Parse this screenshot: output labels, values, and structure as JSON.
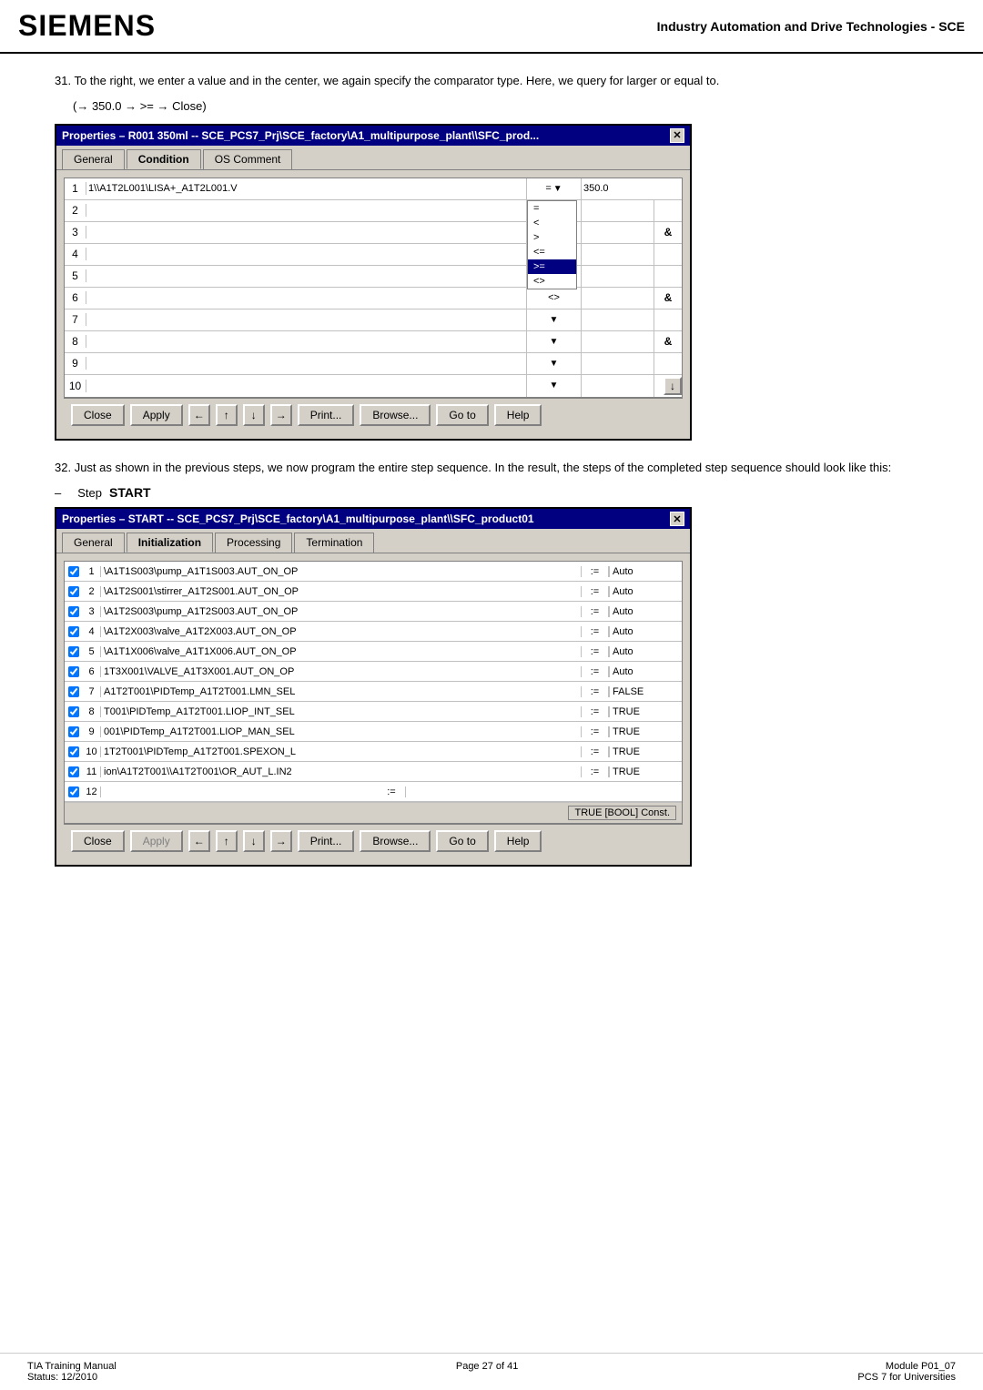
{
  "header": {
    "logo": "SIEMENS",
    "title": "Industry Automation and Drive Technologies - SCE"
  },
  "step31": {
    "number": "31.",
    "text": "To the right, we enter a value and in the center, we again specify the comparator type. Here, we query for larger or equal to.",
    "formula": "(→ 350.0 → >= → Close)"
  },
  "dialog1": {
    "title": "Properties – R001 350ml -- SCE_PCS7_Prj\\SCE_factory\\A1_multipurpose_plant\\\\SFC_prod...",
    "tabs": [
      "General",
      "Condition",
      "OS Comment"
    ],
    "active_tab": "Condition",
    "rows": [
      {
        "num": 1,
        "field": "1\\\\A1T2L001\\LISA+_A1T2L001.V",
        "op": "=",
        "value": "350.0",
        "amp": ""
      },
      {
        "num": 2,
        "field": "",
        "op": "=",
        "value": "",
        "amp": ""
      },
      {
        "num": 3,
        "field": "",
        "op": "<",
        "value": "",
        "amp": "&"
      },
      {
        "num": 4,
        "field": "",
        "op": ">",
        "value": "",
        "amp": ""
      },
      {
        "num": 5,
        "field": "",
        "op": ">=",
        "value": "",
        "amp": ""
      },
      {
        "num": 6,
        "field": "",
        "op": "<>",
        "value": "",
        "amp": "&"
      },
      {
        "num": 7,
        "field": "",
        "op": "",
        "value": "",
        "amp": ""
      },
      {
        "num": 8,
        "field": "",
        "op": "",
        "value": "",
        "amp": "&"
      },
      {
        "num": 9,
        "field": "",
        "op": "",
        "value": "",
        "amp": ""
      },
      {
        "num": 10,
        "field": "",
        "op": "",
        "value": "",
        "amp": ""
      }
    ],
    "op_dropdown_items": [
      "=",
      "<",
      ">",
      "<=",
      ">=",
      "<>"
    ],
    "buttons": {
      "close": "Close",
      "apply": "Apply",
      "print": "Print...",
      "browse": "Browse...",
      "goto": "Go to",
      "help": "Help"
    }
  },
  "step32": {
    "number": "32.",
    "text": "Just as shown in the previous steps, we now program the entire step sequence. In the result, the steps of the completed step sequence should look like this:"
  },
  "step_start": {
    "dash": "–",
    "label": "Step ",
    "name": "START"
  },
  "dialog2": {
    "title": "Properties – START -- SCE_PCS7_Prj\\SCE_factory\\A1_multipurpose_plant\\\\SFC_product01",
    "tabs": [
      "General",
      "Initialization",
      "Processing",
      "Termination"
    ],
    "active_tab": "Initialization",
    "rows": [
      {
        "num": 1,
        "checked": true,
        "field": "\\A1T1S003\\pump_A1T1S003.AUT_ON_OP",
        "op": ":=",
        "value": "Auto"
      },
      {
        "num": 2,
        "checked": true,
        "field": "\\A1T2S001\\stirrer_A1T2S001.AUT_ON_OP",
        "op": ":=",
        "value": "Auto"
      },
      {
        "num": 3,
        "checked": true,
        "field": "\\A1T2S003\\pump_A1T2S003.AUT_ON_OP",
        "op": ":=",
        "value": "Auto"
      },
      {
        "num": 4,
        "checked": true,
        "field": "\\A1T2X003\\valve_A1T2X003.AUT_ON_OP",
        "op": ":=",
        "value": "Auto"
      },
      {
        "num": 5,
        "checked": true,
        "field": "\\A1T1X006\\valve_A1T1X006.AUT_ON_OP",
        "op": ":=",
        "value": "Auto"
      },
      {
        "num": 6,
        "checked": true,
        "field": "1T3X001\\VALVE_A1T3X001.AUT_ON_OP",
        "op": ":=",
        "value": "Auto"
      },
      {
        "num": 7,
        "checked": true,
        "field": "A1T2T001\\PIDTemp_A1T2T001.LMN_SEL",
        "op": ":=",
        "value": "FALSE"
      },
      {
        "num": 8,
        "checked": true,
        "field": "T001\\PIDTemp_A1T2T001.LIOP_INT_SEL",
        "op": ":=",
        "value": "TRUE"
      },
      {
        "num": 9,
        "checked": true,
        "field": "001\\PIDTemp_A1T2T001.LIOP_MAN_SEL",
        "op": ":=",
        "value": "TRUE"
      },
      {
        "num": 10,
        "checked": true,
        "field": "1T2T001\\PIDTemp_A1T2T001.SPEXON_L",
        "op": ":=",
        "value": "TRUE"
      },
      {
        "num": 11,
        "checked": true,
        "field": "ion\\A1T2T001\\\\A1T2T001\\OR_AUT_L.IN2",
        "op": ":=",
        "value": "TRUE"
      },
      {
        "num": 12,
        "checked": true,
        "field": "",
        "op": ":=",
        "value": ""
      }
    ],
    "bool_label": "TRUE [BOOL] Const.",
    "buttons": {
      "close": "Close",
      "apply": "Apply",
      "print": "Print...",
      "browse": "Browse...",
      "goto": "Go to",
      "help": "Help"
    }
  },
  "footer": {
    "left_line1": "TIA Training Manual",
    "left_line2": "Status: 12/2010",
    "center": "Page 27 of 41",
    "right_line1": "Module P01_07",
    "right_line2": "PCS 7 for Universities"
  }
}
